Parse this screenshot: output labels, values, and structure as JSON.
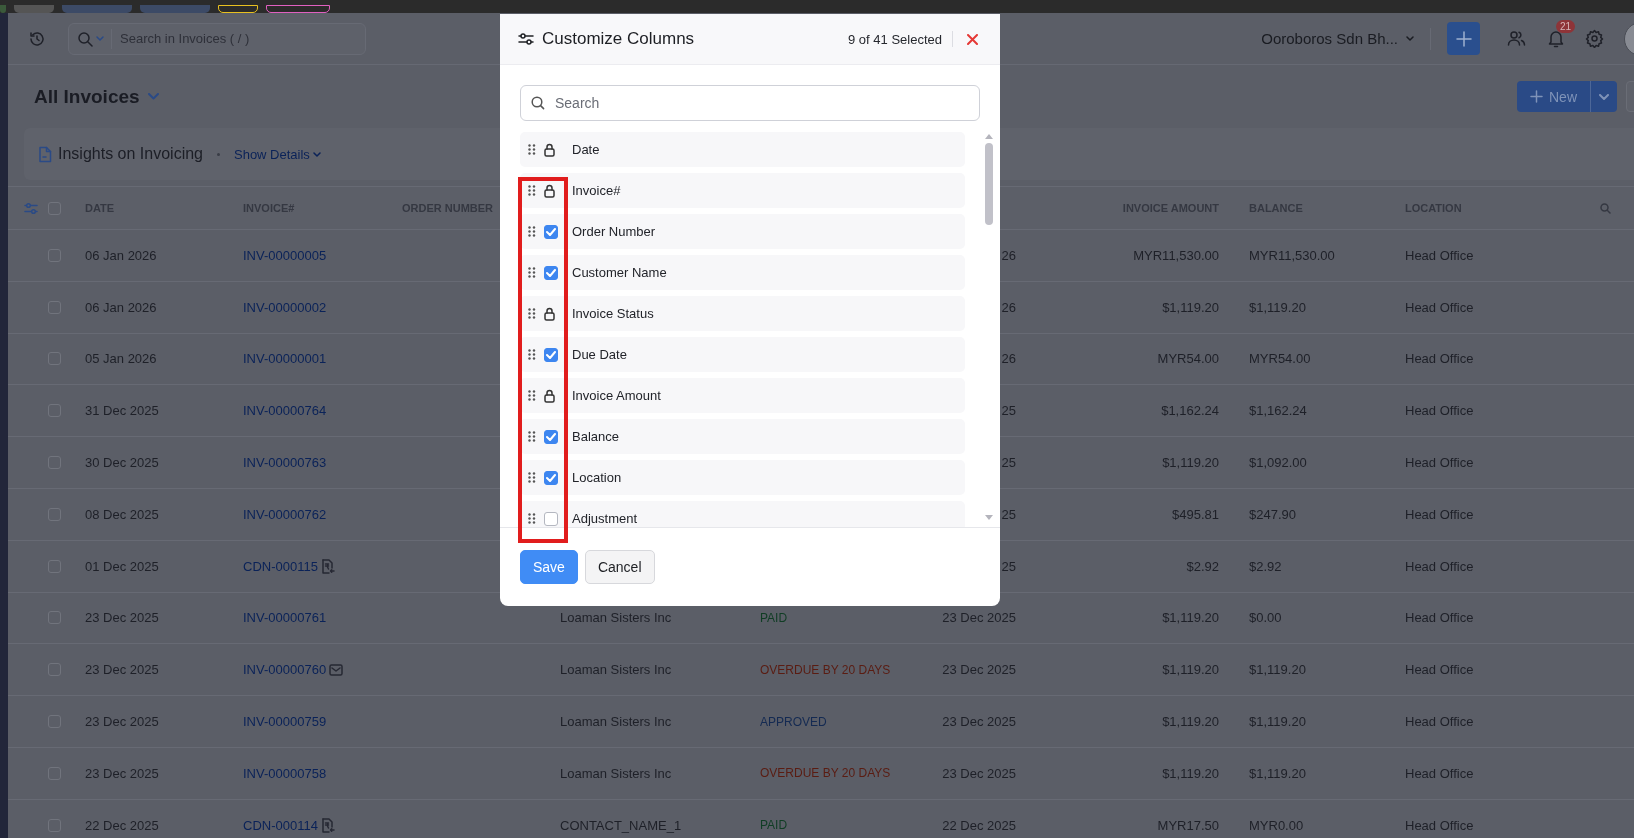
{
  "top_bar": {
    "search": {
      "placeholder": "Search in Invoices ( / )"
    },
    "organization": "Ooroboros Sdn Bh...",
    "notification_count": "21"
  },
  "view": {
    "title": "All Invoices",
    "new_button": "New"
  },
  "insights": {
    "title": "Insights on Invoicing",
    "link": "Show Details"
  },
  "table": {
    "select_all": {
      "checked": false
    },
    "columns": [
      {
        "label": "DATE"
      },
      {
        "label": "INVOICE#"
      },
      {
        "label": "ORDER NUMBER"
      },
      {
        "label": "INVOICE AMOUNT"
      },
      {
        "label": "BALANCE"
      },
      {
        "label": "LOCATION"
      }
    ],
    "rows": [
      {
        "selected": false,
        "date": "06 Jan 2026",
        "number": "INV-00000005",
        "due_date": "26",
        "amount": "MYR11,530.00",
        "balance": "MYR11,530.00",
        "location": "Head Office"
      },
      {
        "selected": false,
        "date": "06 Jan 2026",
        "number": "INV-00000002",
        "due_date": "26",
        "amount": "$1,119.20",
        "balance": "$1,119.20",
        "location": "Head Office"
      },
      {
        "selected": false,
        "date": "05 Jan 2026",
        "number": "INV-00000001",
        "due_date": "26",
        "amount": "MYR54.00",
        "balance": "MYR54.00",
        "location": "Head Office"
      },
      {
        "selected": false,
        "date": "31 Dec 2025",
        "number": "INV-00000764",
        "due_date": "25",
        "amount": "$1,162.24",
        "balance": "$1,162.24",
        "location": "Head Office"
      },
      {
        "selected": false,
        "date": "30 Dec 2025",
        "number": "INV-00000763",
        "due_date": "25",
        "amount": "$1,119.20",
        "balance": "$1,092.00",
        "location": "Head Office"
      },
      {
        "selected": false,
        "date": "08 Dec 2025",
        "number": "INV-00000762",
        "due_date": "25",
        "amount": "$495.81",
        "balance": "$247.90",
        "location": "Head Office"
      },
      {
        "selected": false,
        "date": "01 Dec 2025",
        "number": "CDN-000115",
        "kind": "credit_note",
        "due_date": "25",
        "amount": "$2.92",
        "balance": "$2.92",
        "location": "Head Office"
      },
      {
        "selected": false,
        "date": "23 Dec 2025",
        "number": "INV-00000761",
        "customer": "Loaman Sisters Inc",
        "status": "PAID",
        "color": "#103d24",
        "due_date": "23 Dec 2025",
        "amount": "$1,119.20",
        "balance": "$0.00",
        "location": "Head Office"
      },
      {
        "selected": false,
        "date": "23 Dec 2025",
        "number": "INV-00000760",
        "kind": "emailed",
        "customer": "Loaman Sisters Inc",
        "status": "OVERDUE BY 20 DAYS",
        "color": "#5a1c12",
        "due_date": "23 Dec 2025",
        "amount": "$1,119.20",
        "balance": "$1,119.20",
        "location": "Head Office"
      },
      {
        "selected": false,
        "date": "23 Dec 2025",
        "number": "INV-00000759",
        "customer": "Loaman Sisters Inc",
        "status": "APPROVED",
        "color": "#142a52",
        "due_date": "23 Dec 2025",
        "amount": "$1,119.20",
        "balance": "$1,119.20",
        "location": "Head Office"
      },
      {
        "selected": false,
        "date": "23 Dec 2025",
        "number": "INV-00000758",
        "customer": "Loaman Sisters Inc",
        "status": "OVERDUE BY 20 DAYS",
        "color": "#5a1c12",
        "due_date": "23 Dec 2025",
        "amount": "$1,119.20",
        "balance": "$1,119.20",
        "location": "Head Office"
      },
      {
        "selected": false,
        "date": "22 Dec 2025",
        "number": "CDN-000114",
        "kind": "credit_note",
        "customer": "CONTACT_NAME_1",
        "status": "PAID",
        "color": "#103d24",
        "due_date": "22 Dec 2025",
        "amount": "MYR17.50",
        "balance": "MYR0.00",
        "location": "Head Office"
      }
    ]
  },
  "modal": {
    "title": "Customize Columns",
    "count": "9 of 41 Selected",
    "search": {
      "placeholder": "Search"
    },
    "items": [
      {
        "label": "Date",
        "kind": "locked"
      },
      {
        "label": "Invoice#",
        "kind": "locked"
      },
      {
        "label": "Order Number",
        "kind": "checkbox",
        "checked": true
      },
      {
        "label": "Customer Name",
        "kind": "checkbox",
        "checked": true
      },
      {
        "label": "Invoice Status",
        "kind": "locked"
      },
      {
        "label": "Due Date",
        "kind": "checkbox",
        "checked": true
      },
      {
        "label": "Invoice Amount",
        "kind": "locked"
      },
      {
        "label": "Balance",
        "kind": "checkbox",
        "checked": true
      },
      {
        "label": "Location",
        "kind": "checkbox",
        "checked": true
      },
      {
        "label": "Adjustment",
        "kind": "checkbox",
        "checked": false
      }
    ],
    "buttons": [
      {
        "label": "Save",
        "kind": "primary"
      },
      {
        "label": "Cancel",
        "kind": "secondary"
      }
    ]
  }
}
